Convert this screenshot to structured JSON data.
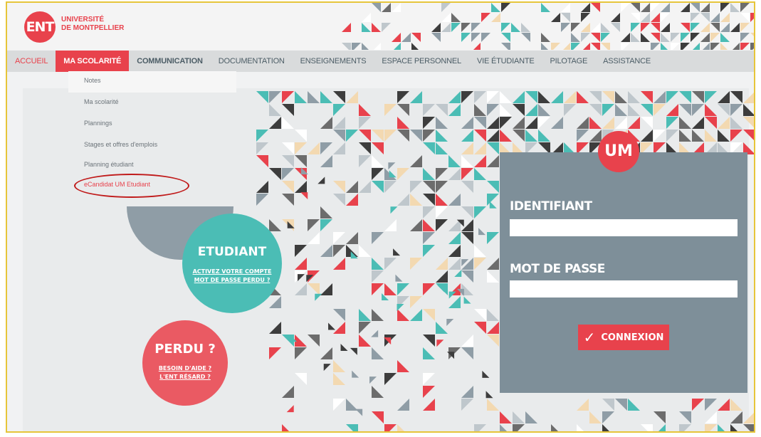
{
  "brand": {
    "logo_text": "ENT",
    "university_line1": "UNIVERSITÉ",
    "university_line2": "DE MONTPELLIER"
  },
  "nav": {
    "items": [
      {
        "label": "ACCUEIL"
      },
      {
        "label": "MA SCOLARITÉ"
      },
      {
        "label": "COMMUNICATION"
      },
      {
        "label": "DOCUMENTATION"
      },
      {
        "label": "ENSEIGNEMENTS"
      },
      {
        "label": "ESPACE PERSONNEL"
      },
      {
        "label": "VIE ÉTUDIANTE"
      },
      {
        "label": "PILOTAGE"
      },
      {
        "label": "ASSISTANCE"
      }
    ]
  },
  "dropdown": {
    "items": [
      {
        "label": "Notes"
      },
      {
        "label": "Ma scolarité"
      },
      {
        "label": "Plannings"
      },
      {
        "label": "Stages et offres d'emplois"
      },
      {
        "label": "Planning étudiant"
      },
      {
        "label": "eCandidat UM Etudiant"
      }
    ]
  },
  "etudiant": {
    "title": "ETUDIANT",
    "link1": "ACTIVEZ VOTRE COMPTE",
    "link2": "MOT DE PASSE PERDU ?"
  },
  "perdu": {
    "title": "PERDU ?",
    "link1": "BESOIN D'AIDE ?",
    "link2": "L'ENT RÉSARD ?"
  },
  "login": {
    "logo_text": "UM",
    "identifiant_label": "IDENTIFIANT",
    "password_label": "MOT DE PASSE",
    "identifiant_value": "",
    "password_value": "",
    "submit_label": "CONNEXION"
  },
  "colors": {
    "accent": "#e8424c",
    "teal": "#4bbdb5",
    "slate": "#7e8f99",
    "highlight_circle": "#c01a1a"
  }
}
